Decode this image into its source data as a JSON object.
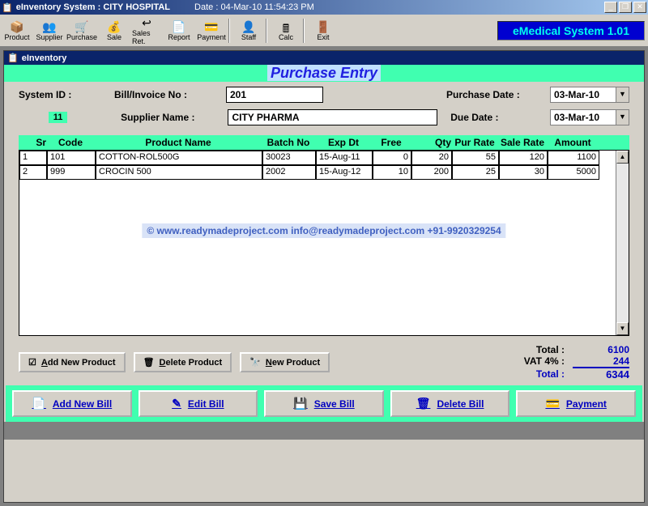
{
  "titlebar": {
    "app": "eInventory System :",
    "context": "CITY HOSPITAL",
    "date_label": "Date :",
    "date_value": "04-Mar-10 11:54:23 PM"
  },
  "toolbar": {
    "items": [
      "Product",
      "Supplier",
      "Purchase",
      "Sale",
      "Sales Ret.",
      "Report",
      "Payment",
      "Staff",
      "Calc",
      "Exit"
    ],
    "icons": [
      "📦",
      "👥",
      "🛒",
      "💰",
      "↩",
      "📄",
      "💳",
      "👤",
      "🖩",
      "🚪"
    ]
  },
  "brand": "eMedical System 1.01",
  "child": {
    "title": "eInventory"
  },
  "page_title": "Purchase Entry",
  "form": {
    "system_id_label": "System ID :",
    "system_id_value": "11",
    "bill_label": "Bill/Invoice No :",
    "bill_value": "201",
    "supplier_label": "Supplier Name :",
    "supplier_value": "CITY PHARMA",
    "purchase_date_label": "Purchase Date :",
    "purchase_date_value": "03-Mar-10",
    "due_date_label": "Due Date :",
    "due_date_value": "03-Mar-10"
  },
  "grid": {
    "headers": {
      "sr": "Sr",
      "code": "Code",
      "name": "Product Name",
      "batch": "Batch No",
      "exp": "Exp Dt",
      "free": "Free",
      "qty": "Qty",
      "rate": "Pur Rate",
      "srate": "Sale Rate",
      "amt": "Amount"
    },
    "rows": [
      {
        "sr": "1",
        "code": "101",
        "name": "COTTON-ROL500G",
        "batch": "30023",
        "exp": "15-Aug-11",
        "free": "0",
        "qty": "20",
        "rate": "55",
        "srate": "120",
        "amt": "1100"
      },
      {
        "sr": "2",
        "code": "999",
        "name": "CROCIN 500",
        "batch": "2002",
        "exp": "15-Aug-12",
        "free": "10",
        "qty": "200",
        "rate": "25",
        "srate": "30",
        "amt": "5000"
      }
    ]
  },
  "watermark": "©  www.readymadeproject.com  info@readymadeproject.com  +91-9920329254",
  "mid_buttons": {
    "add": "Add New Product",
    "del": "Delete Product",
    "new": "New Product"
  },
  "totals": {
    "total_label": "Total :",
    "total_value": "6100",
    "vat_label": "VAT 4% :",
    "vat_value": "244",
    "final_label": "Total :",
    "final_value": "6344"
  },
  "bottom_buttons": {
    "add": "Add New Bill",
    "edit": "Edit Bill",
    "save": "Save Bill",
    "del": "Delete Bill",
    "pay": "Payment"
  }
}
